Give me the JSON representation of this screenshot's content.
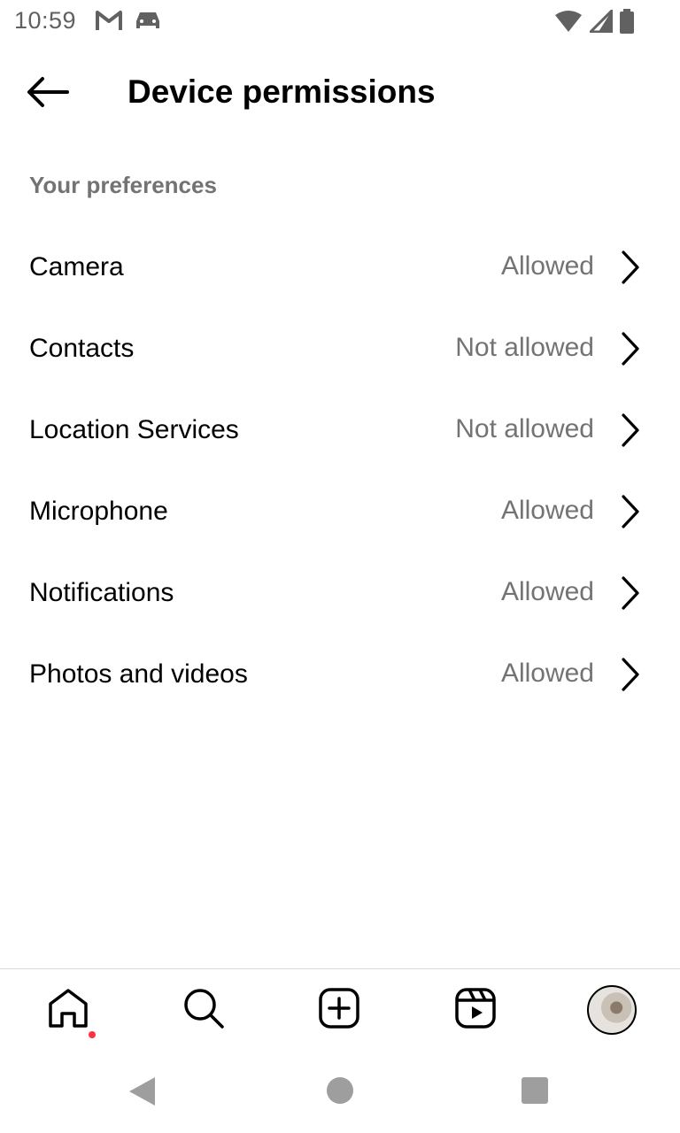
{
  "status_bar": {
    "time": "10:59",
    "left_icons": [
      "gmail-icon",
      "car-icon"
    ],
    "right_icons": [
      "wifi-icon",
      "cell-signal-icon",
      "battery-icon"
    ]
  },
  "header": {
    "title": "Device permissions",
    "back_icon": "arrow-left-icon"
  },
  "section": {
    "label": "Your preferences"
  },
  "permissions": [
    {
      "label": "Camera",
      "status": "Allowed"
    },
    {
      "label": "Contacts",
      "status": "Not allowed"
    },
    {
      "label": "Location Services",
      "status": "Not allowed"
    },
    {
      "label": "Microphone",
      "status": "Allowed"
    },
    {
      "label": "Notifications",
      "status": "Allowed"
    },
    {
      "label": "Photos and videos",
      "status": "Allowed"
    }
  ],
  "bottom_nav": {
    "items": [
      "home-icon",
      "search-icon",
      "create-icon",
      "reels-icon",
      "profile-avatar"
    ],
    "notification_color": "#ff3040"
  },
  "system_nav": [
    "back-triangle",
    "home-circle",
    "recents-square"
  ]
}
